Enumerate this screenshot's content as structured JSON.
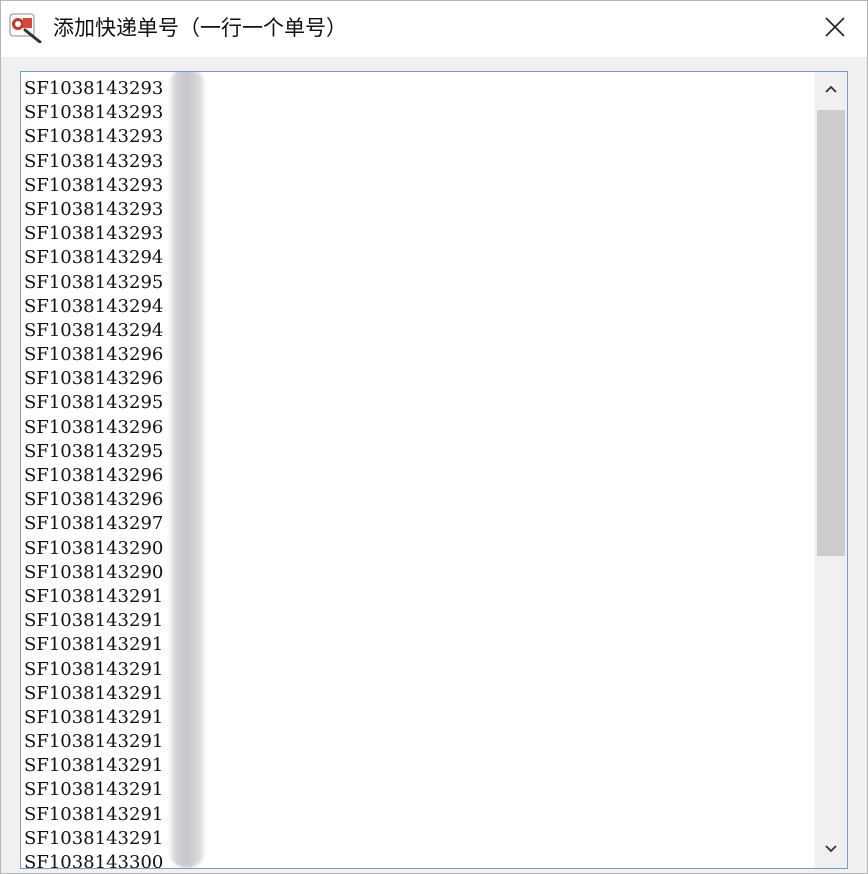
{
  "window": {
    "title": "添加快递单号（一行一个单号）",
    "icon": "app-logo-icon",
    "close_icon": "close-icon"
  },
  "textarea": {
    "lines": [
      "SF1038143293",
      "SF1038143293",
      "SF1038143293",
      "SF1038143293",
      "SF1038143293",
      "SF1038143293",
      "SF1038143293",
      "SF1038143294",
      "SF1038143295",
      "SF1038143294",
      "SF1038143294",
      "SF1038143296",
      "SF1038143296",
      "SF1038143295",
      "SF1038143296",
      "SF1038143295",
      "SF1038143296",
      "SF1038143296",
      "SF1038143297",
      "SF1038143290",
      "SF1038143290",
      "SF1038143291",
      "SF1038143291",
      "SF1038143291",
      "SF1038143291",
      "SF1038143291",
      "SF1038143291",
      "SF1038143291",
      "SF1038143291",
      "SF1038143291",
      "SF1038143291",
      "SF1038143291",
      "SF1038143300"
    ]
  },
  "scrollbar": {
    "up_icon": "chevron-up-icon",
    "down_icon": "chevron-down-icon",
    "thumb_position": 0.0,
    "visible_fraction": 0.62
  },
  "colors": {
    "title_bg": "#ffffff",
    "client_bg": "#f0f0f0",
    "field_border": "#7a9cc6",
    "text": "#111111",
    "scroll_thumb": "#cdcdcd"
  }
}
